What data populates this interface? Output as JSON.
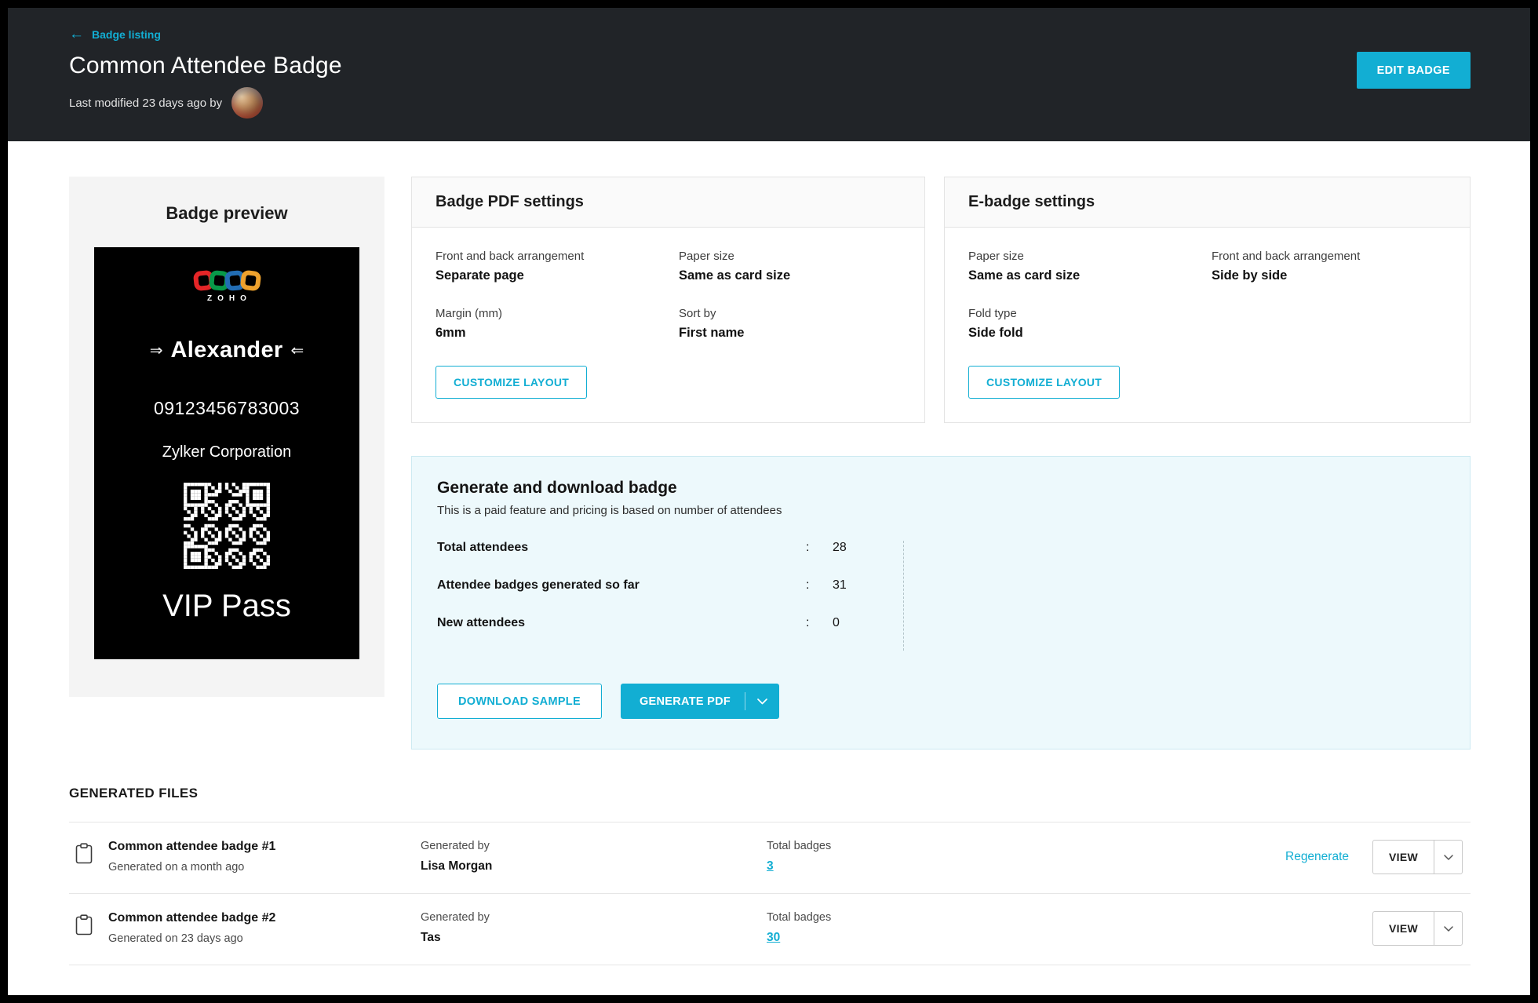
{
  "colors": {
    "accent": "#12aed3",
    "header_bg": "#212428",
    "panel_bg": "#edf9fc",
    "panel_border": "#cdeaf2"
  },
  "header": {
    "back_label": "Badge listing",
    "title": "Common Attendee Badge",
    "last_modified": "Last modified 23 days ago by",
    "edit_button": "EDIT BADGE"
  },
  "badge_preview": {
    "title": "Badge preview",
    "brand": "ZOHO",
    "name": "Alexander",
    "number": "09123456783003",
    "company": "Zylker Corporation",
    "pass_type": "VIP Pass"
  },
  "pdf_settings": {
    "title": "Badge PDF settings",
    "fields": [
      {
        "label": "Front and back arrangement",
        "value": "Separate page"
      },
      {
        "label": "Paper size",
        "value": "Same as card size"
      },
      {
        "label": "Margin (mm)",
        "value": "6mm"
      },
      {
        "label": "Sort by",
        "value": "First name"
      }
    ],
    "customize_button": "CUSTOMIZE LAYOUT"
  },
  "ebadge_settings": {
    "title": "E-badge settings",
    "fields": [
      {
        "label": "Paper size",
        "value": "Same as card size"
      },
      {
        "label": "Front and back arrangement",
        "value": "Side by side"
      },
      {
        "label": "Fold type",
        "value": "Side fold"
      }
    ],
    "customize_button": "CUSTOMIZE LAYOUT"
  },
  "generate": {
    "title": "Generate and download badge",
    "subtitle": "This is a paid feature and pricing is based on number of attendees",
    "colon_char": ":",
    "stats": [
      {
        "label": "Total attendees",
        "value": "28"
      },
      {
        "label": "Attendee badges generated so far",
        "value": "31"
      },
      {
        "label": "New attendees",
        "value": "0"
      }
    ],
    "download_sample": "DOWNLOAD SAMPLE",
    "generate_pdf": "GENERATE PDF"
  },
  "generated_files": {
    "title": "GENERATED FILES",
    "rows": [
      {
        "name": "Common attendee badge #1",
        "generated_on": "Generated on a month ago",
        "generated_by_label": "Generated by",
        "generated_by": "Lisa Morgan",
        "total_badges_label": "Total badges",
        "total_badges": "3",
        "regenerate": "Regenerate",
        "view": "VIEW"
      },
      {
        "name": "Common attendee badge #2",
        "generated_on": "Generated on 23 days ago",
        "generated_by_label": "Generated by",
        "generated_by": "Tas",
        "total_badges_label": "Total badges",
        "total_badges": "30",
        "regenerate": "",
        "view": "VIEW"
      }
    ]
  }
}
